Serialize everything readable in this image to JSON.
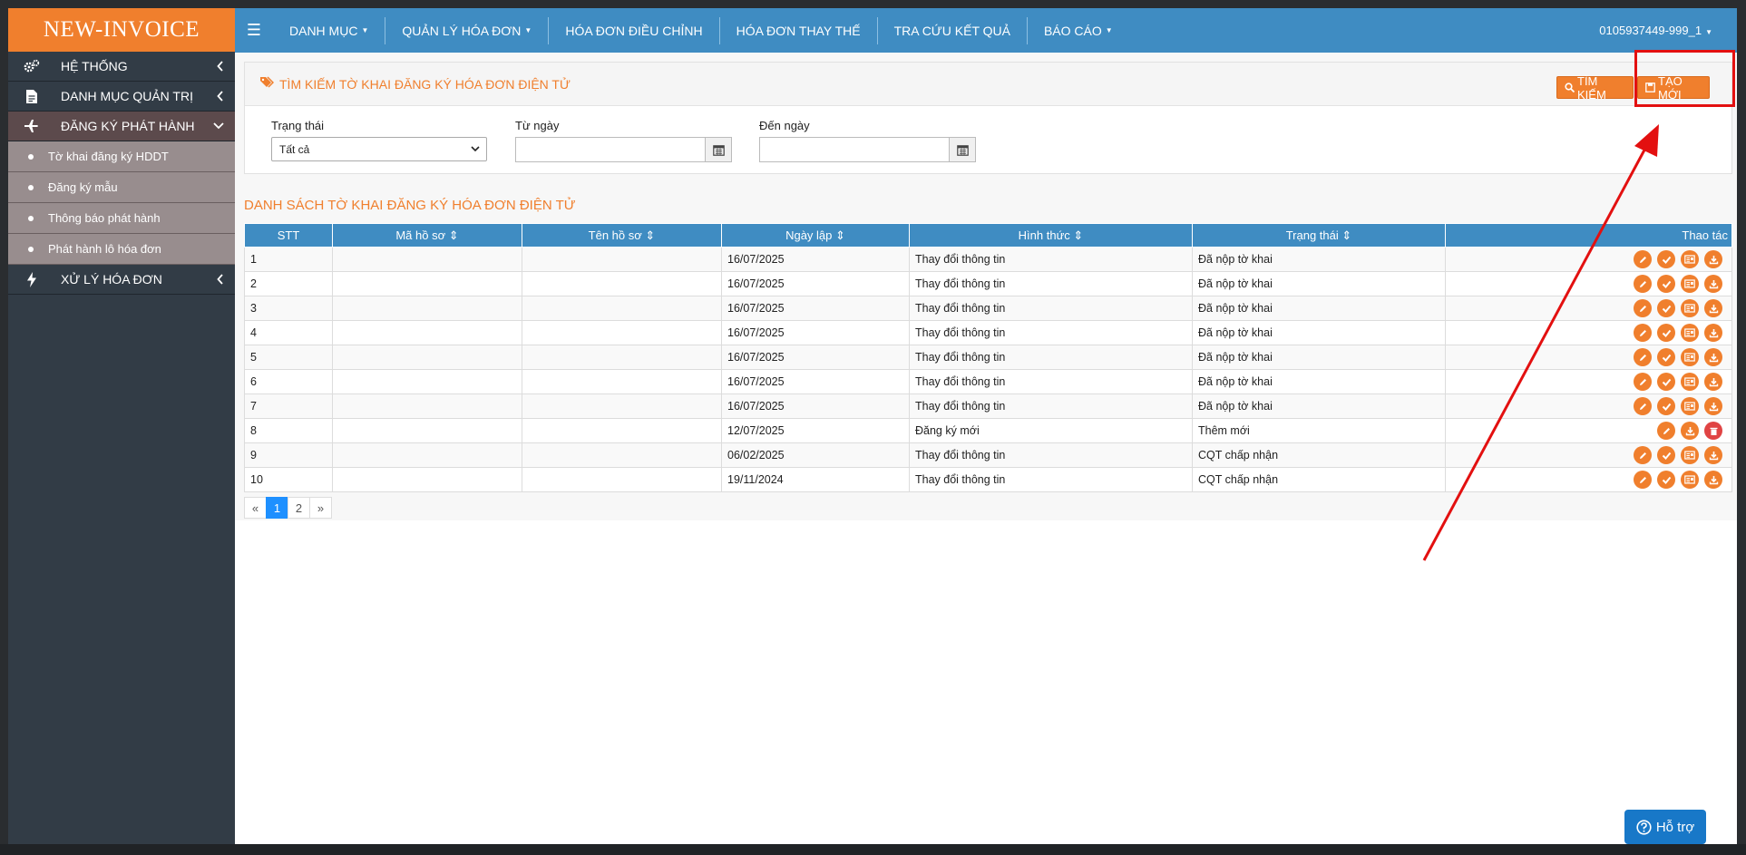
{
  "brand": "NEW-INVOICE",
  "sidebar": {
    "items": [
      {
        "label": "HỆ THỐNG"
      },
      {
        "label": "DANH MỤC QUẢN TRỊ"
      },
      {
        "label": "ĐĂNG KÝ PHÁT HÀNH"
      },
      {
        "label": "XỬ LÝ HÓA ĐƠN"
      }
    ],
    "subitems": [
      {
        "label": "Tờ khai đăng ký HDDT"
      },
      {
        "label": "Đăng ký mẫu"
      },
      {
        "label": "Thông báo phát hành"
      },
      {
        "label": "Phát hành lô hóa đơn"
      }
    ]
  },
  "topnav": {
    "items": [
      "DANH MỤC",
      "QUẢN LÝ HÓA ĐƠN",
      "HÓA ĐƠN ĐIỀU CHỈNH",
      "HÓA ĐƠN THAY THẾ",
      "TRA CỨU KẾT QUẢ",
      "BÁO CÁO"
    ],
    "user": "0105937449-999_1"
  },
  "search": {
    "title": "TÌM KIẾM TỜ KHAI ĐĂNG KÝ HÓA ĐƠN ĐIỆN TỬ",
    "search_btn": "Tìm kiếm",
    "create_btn": "Tạo mới",
    "status_label": "Trạng thái",
    "status_value": "Tất cả",
    "from_label": "Từ ngày",
    "to_label": "Đến ngày"
  },
  "list": {
    "title": "DANH SÁCH TỜ KHAI ĐĂNG KÝ HÓA ĐƠN ĐIỆN TỬ",
    "columns": [
      "STT",
      "Mã hồ sơ",
      "Tên hồ sơ",
      "Ngày lập",
      "Hình thức",
      "Trạng thái",
      "Thao tác"
    ],
    "rows": [
      {
        "stt": "1",
        "ma": "",
        "ten": "",
        "ngay": "16/07/2025",
        "hinhthuc": "Thay đổi thông tin",
        "trangthai": "Đã nộp tờ khai"
      },
      {
        "stt": "2",
        "ma": "",
        "ten": "",
        "ngay": "16/07/2025",
        "hinhthuc": "Thay đổi thông tin",
        "trangthai": "Đã nộp tờ khai"
      },
      {
        "stt": "3",
        "ma": "",
        "ten": "",
        "ngay": "16/07/2025",
        "hinhthuc": "Thay đổi thông tin",
        "trangthai": "Đã nộp tờ khai"
      },
      {
        "stt": "4",
        "ma": "",
        "ten": "",
        "ngay": "16/07/2025",
        "hinhthuc": "Thay đổi thông tin",
        "trangthai": "Đã nộp tờ khai"
      },
      {
        "stt": "5",
        "ma": "",
        "ten": "",
        "ngay": "16/07/2025",
        "hinhthuc": "Thay đổi thông tin",
        "trangthai": "Đã nộp tờ khai"
      },
      {
        "stt": "6",
        "ma": "",
        "ten": "",
        "ngay": "16/07/2025",
        "hinhthuc": "Thay đổi thông tin",
        "trangthai": "Đã nộp tờ khai"
      },
      {
        "stt": "7",
        "ma": "",
        "ten": "",
        "ngay": "16/07/2025",
        "hinhthuc": "Thay đổi thông tin",
        "trangthai": "Đã nộp tờ khai"
      },
      {
        "stt": "8",
        "ma": "",
        "ten": "",
        "ngay": "12/07/2025",
        "hinhthuc": "Đăng ký mới",
        "trangthai": "Thêm mới"
      },
      {
        "stt": "9",
        "ma": "",
        "ten": "",
        "ngay": "06/02/2025",
        "hinhthuc": "Thay đổi thông tin",
        "trangthai": "CQT chấp nhận"
      },
      {
        "stt": "10",
        "ma": "",
        "ten": "",
        "ngay": "19/11/2024",
        "hinhthuc": "Thay đổi thông tin",
        "trangthai": "CQT chấp nhận"
      }
    ]
  },
  "pager": {
    "prev": "«",
    "pages": [
      "1",
      "2"
    ],
    "next": "»",
    "current": "1"
  },
  "help": "Hỗ trợ",
  "colors": {
    "accent": "#f07f2d",
    "primary": "#3f8cc2",
    "sidebar": "#323c46",
    "annotation": "#e31010"
  }
}
